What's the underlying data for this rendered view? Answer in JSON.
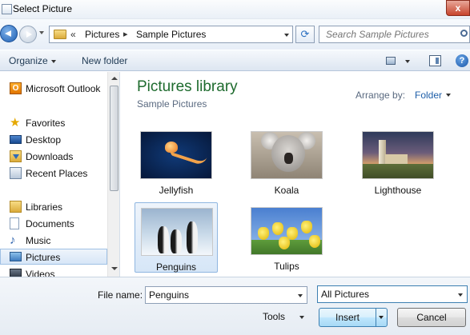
{
  "window": {
    "title": "Select Picture",
    "close_label": "x"
  },
  "nav": {
    "breadcrumb_chevron": "«",
    "breadcrumbs": [
      "Pictures",
      "Sample Pictures"
    ],
    "separator": "▸",
    "search_placeholder": "Search Sample Pictures"
  },
  "toolbar": {
    "organize": "Organize",
    "new_folder": "New folder",
    "help": "?"
  },
  "sidebar": {
    "items": [
      {
        "label": "Microsoft Outlook",
        "icon": "outlook-icon"
      },
      {
        "label": "Favorites",
        "icon": "star-icon"
      },
      {
        "label": "Desktop",
        "icon": "desktop-icon"
      },
      {
        "label": "Downloads",
        "icon": "downloads-icon"
      },
      {
        "label": "Recent Places",
        "icon": "recent-places-icon"
      },
      {
        "label": "Libraries",
        "icon": "libraries-icon"
      },
      {
        "label": "Documents",
        "icon": "documents-icon"
      },
      {
        "label": "Music",
        "icon": "music-icon"
      },
      {
        "label": "Pictures",
        "icon": "pictures-icon",
        "selected": true
      },
      {
        "label": "Videos",
        "icon": "videos-icon"
      }
    ]
  },
  "main": {
    "title": "Pictures library",
    "subtitle": "Sample Pictures",
    "arrange_label": "Arrange by:",
    "arrange_value": "Folder",
    "files": [
      {
        "name": "Jellyfish"
      },
      {
        "name": "Koala"
      },
      {
        "name": "Lighthouse"
      },
      {
        "name": "Penguins",
        "selected": true
      },
      {
        "name": "Tulips"
      }
    ]
  },
  "bottom": {
    "file_name_label": "File name:",
    "file_name_value": "Penguins",
    "filter_value": "All Pictures",
    "tools_label": "Tools",
    "insert_label": "Insert",
    "cancel_label": "Cancel"
  },
  "colors": {
    "library_title": "#1e6b2e",
    "link": "#1d5ea8",
    "selection": "#d6e6f7"
  }
}
